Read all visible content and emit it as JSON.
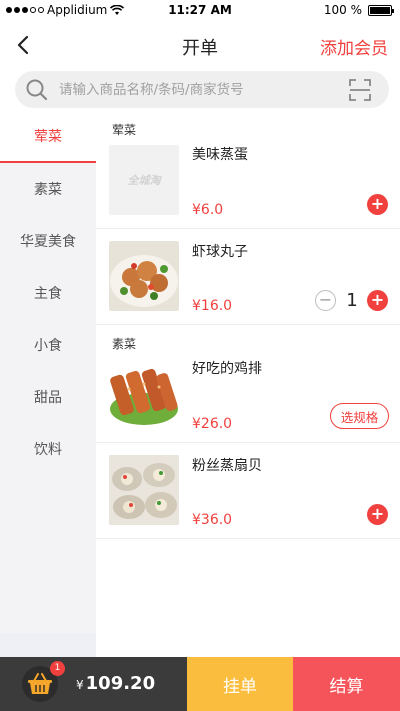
{
  "status_bar": {
    "carrier": "Applidium",
    "time": "11:27 AM",
    "battery_text": "100 %",
    "battery_level": 1.0
  },
  "nav": {
    "title": "开单",
    "add_member": "添加会员"
  },
  "search": {
    "placeholder": "请输入商品名称/条码/商家货号"
  },
  "sidebar": {
    "items": [
      {
        "label": "荤菜",
        "active": true
      },
      {
        "label": "素菜",
        "active": false
      },
      {
        "label": "华夏美食",
        "active": false
      },
      {
        "label": "主食",
        "active": false
      },
      {
        "label": "小食",
        "active": false
      },
      {
        "label": "甜品",
        "active": false
      },
      {
        "label": "饮料",
        "active": false
      }
    ]
  },
  "content": {
    "sections": [
      {
        "label": "荤菜"
      },
      {
        "label": "素菜"
      }
    ],
    "items": [
      {
        "name": "美味蒸蛋",
        "price": "¥6.0",
        "placeholder_text": "全城淘"
      },
      {
        "name": "虾球丸子",
        "price": "¥16.0",
        "quantity": "1",
        "minus": "−",
        "plus": "+"
      },
      {
        "name": "好吃的鸡排",
        "price": "¥26.0",
        "spec_label": "选规格"
      },
      {
        "name": "粉丝蒸扇贝",
        "price": "¥36.0",
        "plus": "+"
      }
    ],
    "plus_symbol": "+"
  },
  "bottom": {
    "badge": "1",
    "currency": "¥",
    "total": "109.20",
    "hold_label": "挂单",
    "checkout_label": "结算"
  },
  "colors": {
    "accent": "#f0413e",
    "hold": "#fbbd3d",
    "checkout": "#f5555a",
    "cart_bg": "#3b3b3b"
  }
}
